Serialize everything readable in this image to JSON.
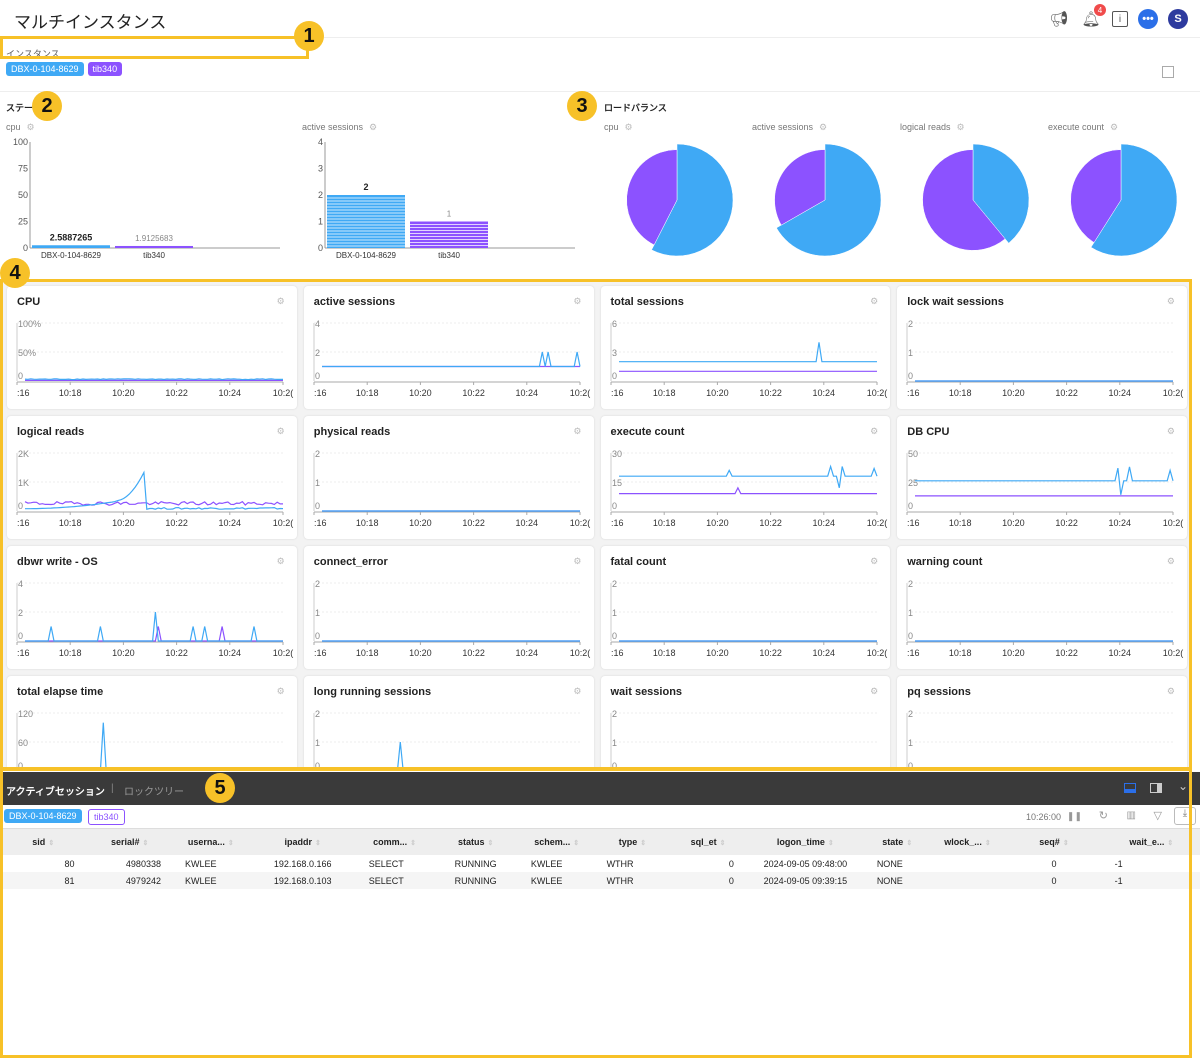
{
  "header": {
    "title": "マルチインスタンス",
    "notification_count": "4",
    "avatar_initial": "S",
    "chat_glyph": "•••"
  },
  "instances": {
    "label": "インスタンス",
    "items": [
      {
        "name": "DBX-0-104-8629",
        "color": "#3fa9f5"
      },
      {
        "name": "tib340",
        "color": "#8c52ff"
      }
    ]
  },
  "status": {
    "title": "ステータス",
    "cpu_label": "cpu",
    "sessions_label": "active sessions"
  },
  "loadbalance": {
    "title": "ロードバランス",
    "labels": [
      "cpu",
      "active sessions",
      "logical reads",
      "execute count"
    ]
  },
  "annotations": [
    "1",
    "2",
    "3",
    "4",
    "5"
  ],
  "colors": {
    "blue": "#3fa9f5",
    "purple": "#8c52ff"
  },
  "chart_data": [
    {
      "type": "bar",
      "title": "cpu",
      "categories": [
        "DBX-0-104-8629",
        "tib340"
      ],
      "values": [
        2.5887265,
        1.9125683
      ],
      "value_labels": [
        "2.5887265",
        "1.9125683"
      ],
      "yticks": [
        "0",
        "25",
        "50",
        "75",
        "100"
      ],
      "ylim": [
        0,
        100
      ]
    },
    {
      "type": "bar",
      "title": "active sessions",
      "categories": [
        "DBX-0-104-8629",
        "tib340"
      ],
      "values": [
        2,
        1
      ],
      "value_labels": [
        "2",
        "1"
      ],
      "yticks": [
        "0",
        "1",
        "2",
        "3",
        "4"
      ],
      "ylim": [
        0,
        4
      ]
    },
    {
      "type": "pie",
      "title": "cpu",
      "values": [
        57.5,
        42.5
      ],
      "labels": [
        "DBX-0-104-8629",
        "tib340"
      ]
    },
    {
      "type": "pie",
      "title": "active sessions",
      "values": [
        66.7,
        33.3
      ],
      "labels": [
        "DBX-0-104-8629",
        "tib340"
      ]
    },
    {
      "type": "pie",
      "title": "logical reads",
      "values": [
        39,
        61
      ],
      "labels": [
        "DBX-0-104-8629",
        "tib340"
      ]
    },
    {
      "type": "pie",
      "title": "execute count",
      "values": [
        59,
        41
      ],
      "labels": [
        "DBX-0-104-8629",
        "tib340"
      ]
    }
  ],
  "line_charts": [
    {
      "title": "CPU",
      "yticks": [
        "0",
        "50%",
        "100%"
      ],
      "ymax": 100,
      "blue": "noise:3",
      "purple": "flat:1"
    },
    {
      "title": "active sessions",
      "yticks": [
        "0",
        "2",
        "4"
      ],
      "ymax": 4,
      "blue": "flat:1|spike:0.85:2|spike:0.88:2|spike:0.99:2",
      "purple": "flat:1"
    },
    {
      "title": "total sessions",
      "yticks": [
        "0",
        "3",
        "6"
      ],
      "ymax": 6,
      "blue": "flat:2|spike:0.77:4",
      "purple": "flat:1"
    },
    {
      "title": "lock wait sessions",
      "yticks": [
        "0",
        "1",
        "2"
      ],
      "ymax": 2,
      "blue": "flat:0",
      "purple": "flat:0"
    },
    {
      "title": "logical reads",
      "yticks": [
        "0",
        "1K",
        "2K"
      ],
      "ymax": 2000,
      "blue": "hump",
      "purple": "noise:250"
    },
    {
      "title": "physical reads",
      "yticks": [
        "0",
        "1",
        "2"
      ],
      "ymax": 2,
      "blue": "flat:0",
      "purple": "flat:0"
    },
    {
      "title": "execute count",
      "yticks": [
        "0",
        "15",
        "30"
      ],
      "ymax": 30,
      "blue": "flat:18|spike:0.43:21|spike:0.82:23|spike:0.85:12|spike:0.87:23|spike:0.99:22",
      "purple": "flat:9|spike:0.46:12"
    },
    {
      "title": "DB CPU",
      "yticks": [
        "0",
        "25",
        "50"
      ],
      "ymax": 50,
      "blue": "flat:26|spike:0.79:37|spike:0.8:14|spike:0.83:38|spike:0.99:35",
      "purple": "flat:13"
    },
    {
      "title": "dbwr write - OS",
      "yticks": [
        "0",
        "2",
        "4"
      ],
      "ymax": 4,
      "blue": "flat:0|spike:0.1:1|spike:0.29:1|spike:0.5:2|spike:0.65:1|spike:0.7:1|spike:0.89:1",
      "purple": "flat:0|spike:0.52:1|spike:0.76:1"
    },
    {
      "title": "connect_error",
      "yticks": [
        "0",
        "1",
        "2"
      ],
      "ymax": 2,
      "blue": "flat:0",
      "purple": "flat:0"
    },
    {
      "title": "fatal count",
      "yticks": [
        "0",
        "1",
        "2"
      ],
      "ymax": 2,
      "blue": "flat:0",
      "purple": "flat:0"
    },
    {
      "title": "warning count",
      "yticks": [
        "0",
        "1",
        "2"
      ],
      "ymax": 2,
      "blue": "flat:0",
      "purple": "flat:0"
    },
    {
      "title": "total elapse time",
      "yticks": [
        "0",
        "60",
        "120"
      ],
      "ymax": 120,
      "blue": "flat:0|spike:0.3:100",
      "purple": "flat:0"
    },
    {
      "title": "long running sessions",
      "yticks": [
        "0",
        "1",
        "2"
      ],
      "ymax": 2,
      "blue": "flat:0|spike:0.3:1",
      "purple": "flat:0"
    },
    {
      "title": "wait sessions",
      "yticks": [
        "0",
        "1",
        "2"
      ],
      "ymax": 2,
      "blue": "flat:0",
      "purple": "flat:0"
    },
    {
      "title": "pq sessions",
      "yticks": [
        "0",
        "1",
        "2"
      ],
      "ymax": 2,
      "blue": "flat:0",
      "purple": "flat:0"
    }
  ],
  "xticks": [
    ":16",
    "10:18",
    "10:20",
    "10:22",
    "10:24",
    "10:2("
  ],
  "bottom": {
    "tab_active": "アクティブセッション",
    "tab_sep": "|",
    "tab_inactive": "ロックツリー",
    "time": "10:26:00",
    "columns": [
      "sid",
      "serial#",
      "userna...",
      "ipaddr",
      "comm...",
      "status",
      "schem...",
      "type",
      "sql_et",
      "logon_time",
      "state",
      "wlock_...",
      "seq#",
      "wait_e..."
    ],
    "rows": [
      [
        "80",
        "4980338",
        "KWLEE",
        "192.168.0.166",
        "SELECT",
        "RUNNING",
        "KWLEE",
        "WTHR",
        "0",
        "2024-09-05 09:48:00",
        "NONE",
        "",
        "0",
        "-1"
      ],
      [
        "81",
        "4979242",
        "KWLEE",
        "192.168.0.103",
        "SELECT",
        "RUNNING",
        "KWLEE",
        "WTHR",
        "0",
        "2024-09-05 09:39:15",
        "NONE",
        "",
        "0",
        "-1"
      ]
    ]
  }
}
